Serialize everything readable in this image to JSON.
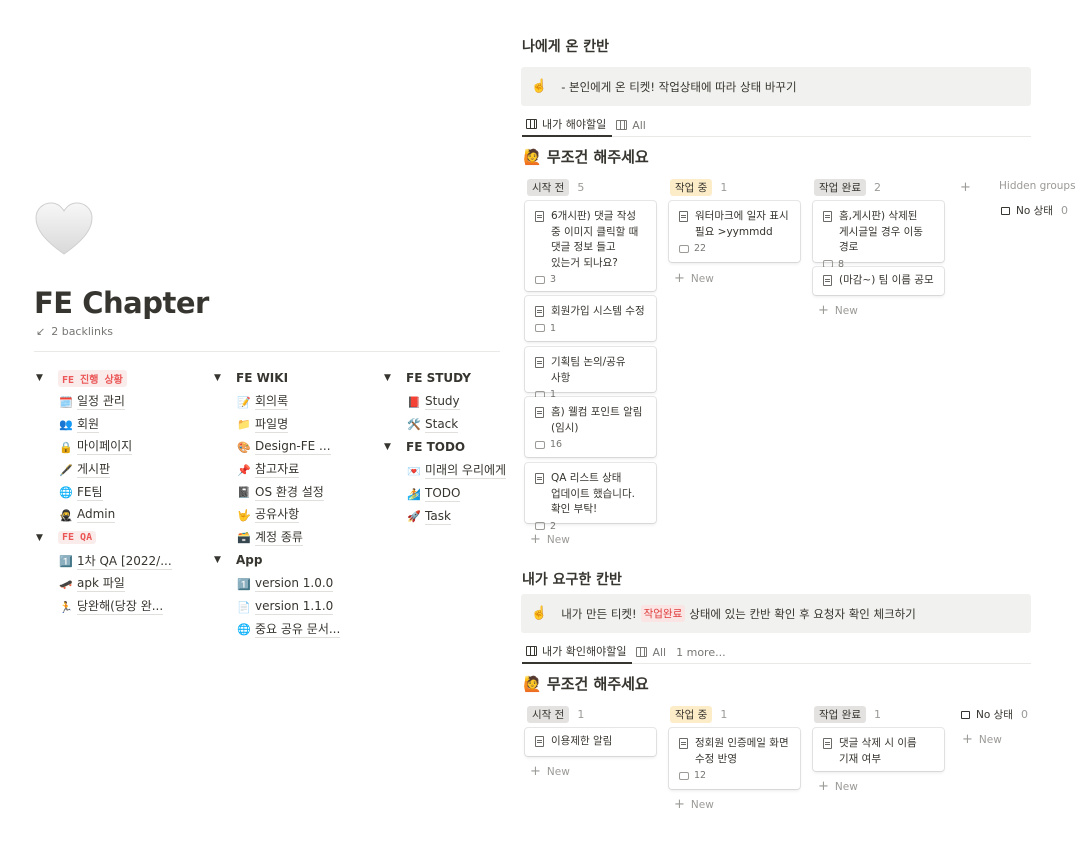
{
  "page": {
    "title": "FE Chapter",
    "backlinks": "2 backlinks",
    "icon": "white-heart-icon"
  },
  "tree": [
    {
      "head": "FE 진행 상황",
      "code": true,
      "items": [
        {
          "icon": "🗓️",
          "label": "일정 관리"
        },
        {
          "icon": "👥",
          "label": "회원"
        },
        {
          "icon": "🔒",
          "label": "마이페이지"
        },
        {
          "icon": "🖋️",
          "label": "게시판"
        },
        {
          "icon": "🌐",
          "label": "FE팀"
        },
        {
          "icon": "🥷",
          "label": "Admin"
        }
      ]
    },
    {
      "head": "FE QA",
      "code": true,
      "items": [
        {
          "icon": "1️⃣",
          "label": "1차 QA [2022/..."
        },
        {
          "icon": "🛹",
          "label": "apk 파일"
        },
        {
          "icon": "🏃",
          "label": "당완해(당장 완..."
        }
      ]
    },
    {
      "head": "FE WIKI",
      "code": false,
      "items": [
        {
          "icon": "📝",
          "label": "회의록"
        },
        {
          "icon": "📁",
          "label": "파일명"
        },
        {
          "icon": "🎨",
          "label": "Design-FE ..."
        },
        {
          "icon": "📌",
          "label": "참고자료"
        },
        {
          "icon": "📓",
          "label": "OS 환경 설정"
        },
        {
          "icon": "🤟",
          "label": "공유사항"
        },
        {
          "icon": "🗃️",
          "label": "계정 종류"
        }
      ]
    },
    {
      "head": "App",
      "code": false,
      "items": [
        {
          "icon": "1️⃣",
          "label": "version 1.0.0"
        },
        {
          "icon": "📄",
          "label": "version 1.1.0"
        },
        {
          "icon": "🌐",
          "label": "중요 공유 문서..."
        }
      ]
    },
    {
      "head": "FE STUDY",
      "code": false,
      "items": [
        {
          "icon": "📕",
          "label": "Study"
        },
        {
          "icon": "🛠️",
          "label": "Stack"
        }
      ]
    },
    {
      "head": "FE TODO",
      "code": false,
      "items": [
        {
          "icon": "💌",
          "label": "미래의 우리에게"
        },
        {
          "icon": "🏄",
          "label": "TODO"
        },
        {
          "icon": "🚀",
          "label": "Task"
        }
      ]
    }
  ],
  "board1": {
    "title": "나에게 온 칸반",
    "callout_icon": "☝️",
    "callout": "- 본인에게 온 티켓! 작업상태에 따라 상태 바꾸기",
    "tabs": [
      "내가 해야할일",
      "All"
    ],
    "view_title": "🙋 무조건 해주세요",
    "columns": [
      {
        "status": "시작 전",
        "count": "5",
        "cards": [
          {
            "title": "6개시판) 댓글 작성 중 이미지 클릭할 때 댓글 정보 들고 있는거 되나요?",
            "comments": "3"
          },
          {
            "title": "회원가입 시스템 수정",
            "comments": "1"
          },
          {
            "title": "기획팀 논의/공유 사항",
            "comments": "1"
          },
          {
            "title": "홈) 웰컴 포인트 알림(임시)",
            "comments": "16"
          },
          {
            "title": "QA 리스트 상태 업데이트 했습니다. 확인 부탁!",
            "comments": "2"
          }
        ]
      },
      {
        "status": "작업 중",
        "count": "1",
        "cards": [
          {
            "title": "워터마크에 일자 표시 필요 >yymmdd",
            "comments": "22"
          }
        ]
      },
      {
        "status": "작업 완료",
        "count": "2",
        "cards": [
          {
            "title": "홈,게시판) 삭제된 게시글일 경우 이동 경로",
            "comments": "8"
          },
          {
            "title": "(마감~) 팀 이름 공모",
            "comments": ""
          }
        ]
      }
    ],
    "new_label": "New",
    "hidden_groups": "Hidden groups",
    "no_status": "No 상태",
    "no_status_count": "0"
  },
  "board2": {
    "title": "내가 요구한 칸반",
    "callout_icon": "☝️",
    "callout_pre": "내가 만든 티켓!",
    "callout_tag": "작업완료",
    "callout_post": "상태에 있는 칸반 확인 후 요청자 확인 체크하기",
    "tabs": [
      "내가 확인해야할일",
      "All",
      "1 more..."
    ],
    "view_title": "🙋 무조건 해주세요",
    "columns": [
      {
        "status": "시작 전",
        "count": "1",
        "cards": [
          {
            "title": "이용제한 알림",
            "comments": ""
          }
        ]
      },
      {
        "status": "작업 중",
        "count": "1",
        "cards": [
          {
            "title": "정회원 인증메일 화면 수정 반영",
            "comments": "12"
          }
        ]
      },
      {
        "status": "작업 완료",
        "count": "1",
        "cards": [
          {
            "title": "댓글 삭제 시 이름 기재 여부",
            "comments": ""
          }
        ]
      }
    ],
    "no_status": "No 상태",
    "no_status_count": "0",
    "new_label": "New"
  }
}
